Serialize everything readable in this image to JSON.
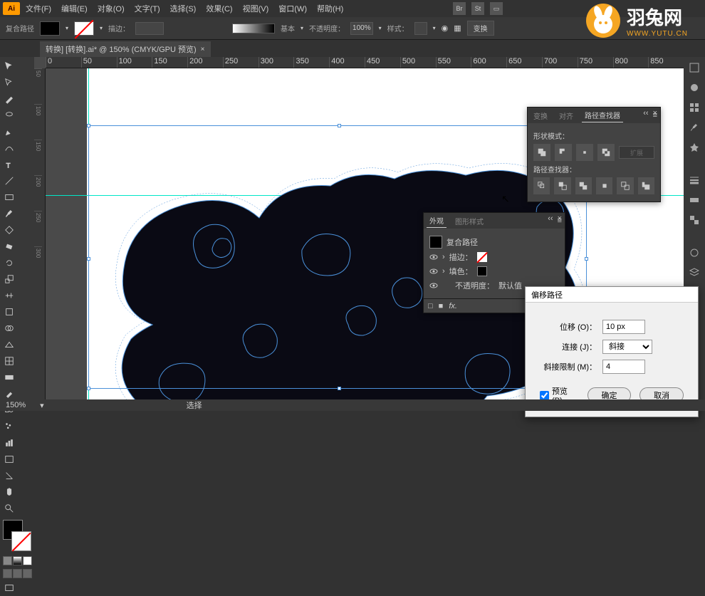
{
  "menu": {
    "file": "文件(F)",
    "edit": "编辑(E)",
    "object": "对象(O)",
    "type": "文字(T)",
    "select": "选择(S)",
    "effect": "效果(C)",
    "view": "视图(V)",
    "window": "窗口(W)",
    "help": "帮助(H)"
  },
  "top_icons": {
    "br": "Br",
    "st": "St"
  },
  "control": {
    "label": "复合路径",
    "stroke_label": "描边：",
    "stroke_value": "",
    "style_label": "基本",
    "opacity_label": "不透明度：",
    "opacity_value": "100%",
    "appearance_label": "样式：",
    "transform_btn": "变换"
  },
  "doc_tab": {
    "title": "转换] [转换].ai* @ 150% (CMYK/GPU 预览)"
  },
  "ruler_marks_h": [
    "0",
    "50",
    "100",
    "150",
    "200",
    "250",
    "300",
    "350",
    "400",
    "450",
    "500",
    "550",
    "600",
    "650",
    "700",
    "750",
    "800",
    "850"
  ],
  "ruler_marks_v": [
    "50",
    "100",
    "150",
    "200",
    "250",
    "300"
  ],
  "pathfinder_panel": {
    "tab1": "变换",
    "tab2": "对齐",
    "tab3": "路径查找器",
    "shape_label": "形状模式：",
    "pf_label": "路径查找器：",
    "extend": "扩展"
  },
  "appearance_panel": {
    "tab1": "外观",
    "tab2": "图形样式",
    "object_label": "复合路径",
    "stroke_label": "描边：",
    "fill_label": "填色：",
    "opacity_label": "不透明度：",
    "opacity_value": "默认值"
  },
  "dialog": {
    "title": "偏移路径",
    "offset_label": "位移 (O)：",
    "offset_value": "10 px",
    "join_label": "连接 (J)：",
    "join_value": "斜接",
    "miter_label": "斜接限制 (M)：",
    "miter_value": "4",
    "preview_label": "预览 (P)",
    "ok": "确定",
    "cancel": "取消"
  },
  "status": {
    "zoom": "150%",
    "tool": "选择"
  },
  "logo": {
    "main": "羽兔网",
    "sub": "WWW.YUTU.CN"
  }
}
